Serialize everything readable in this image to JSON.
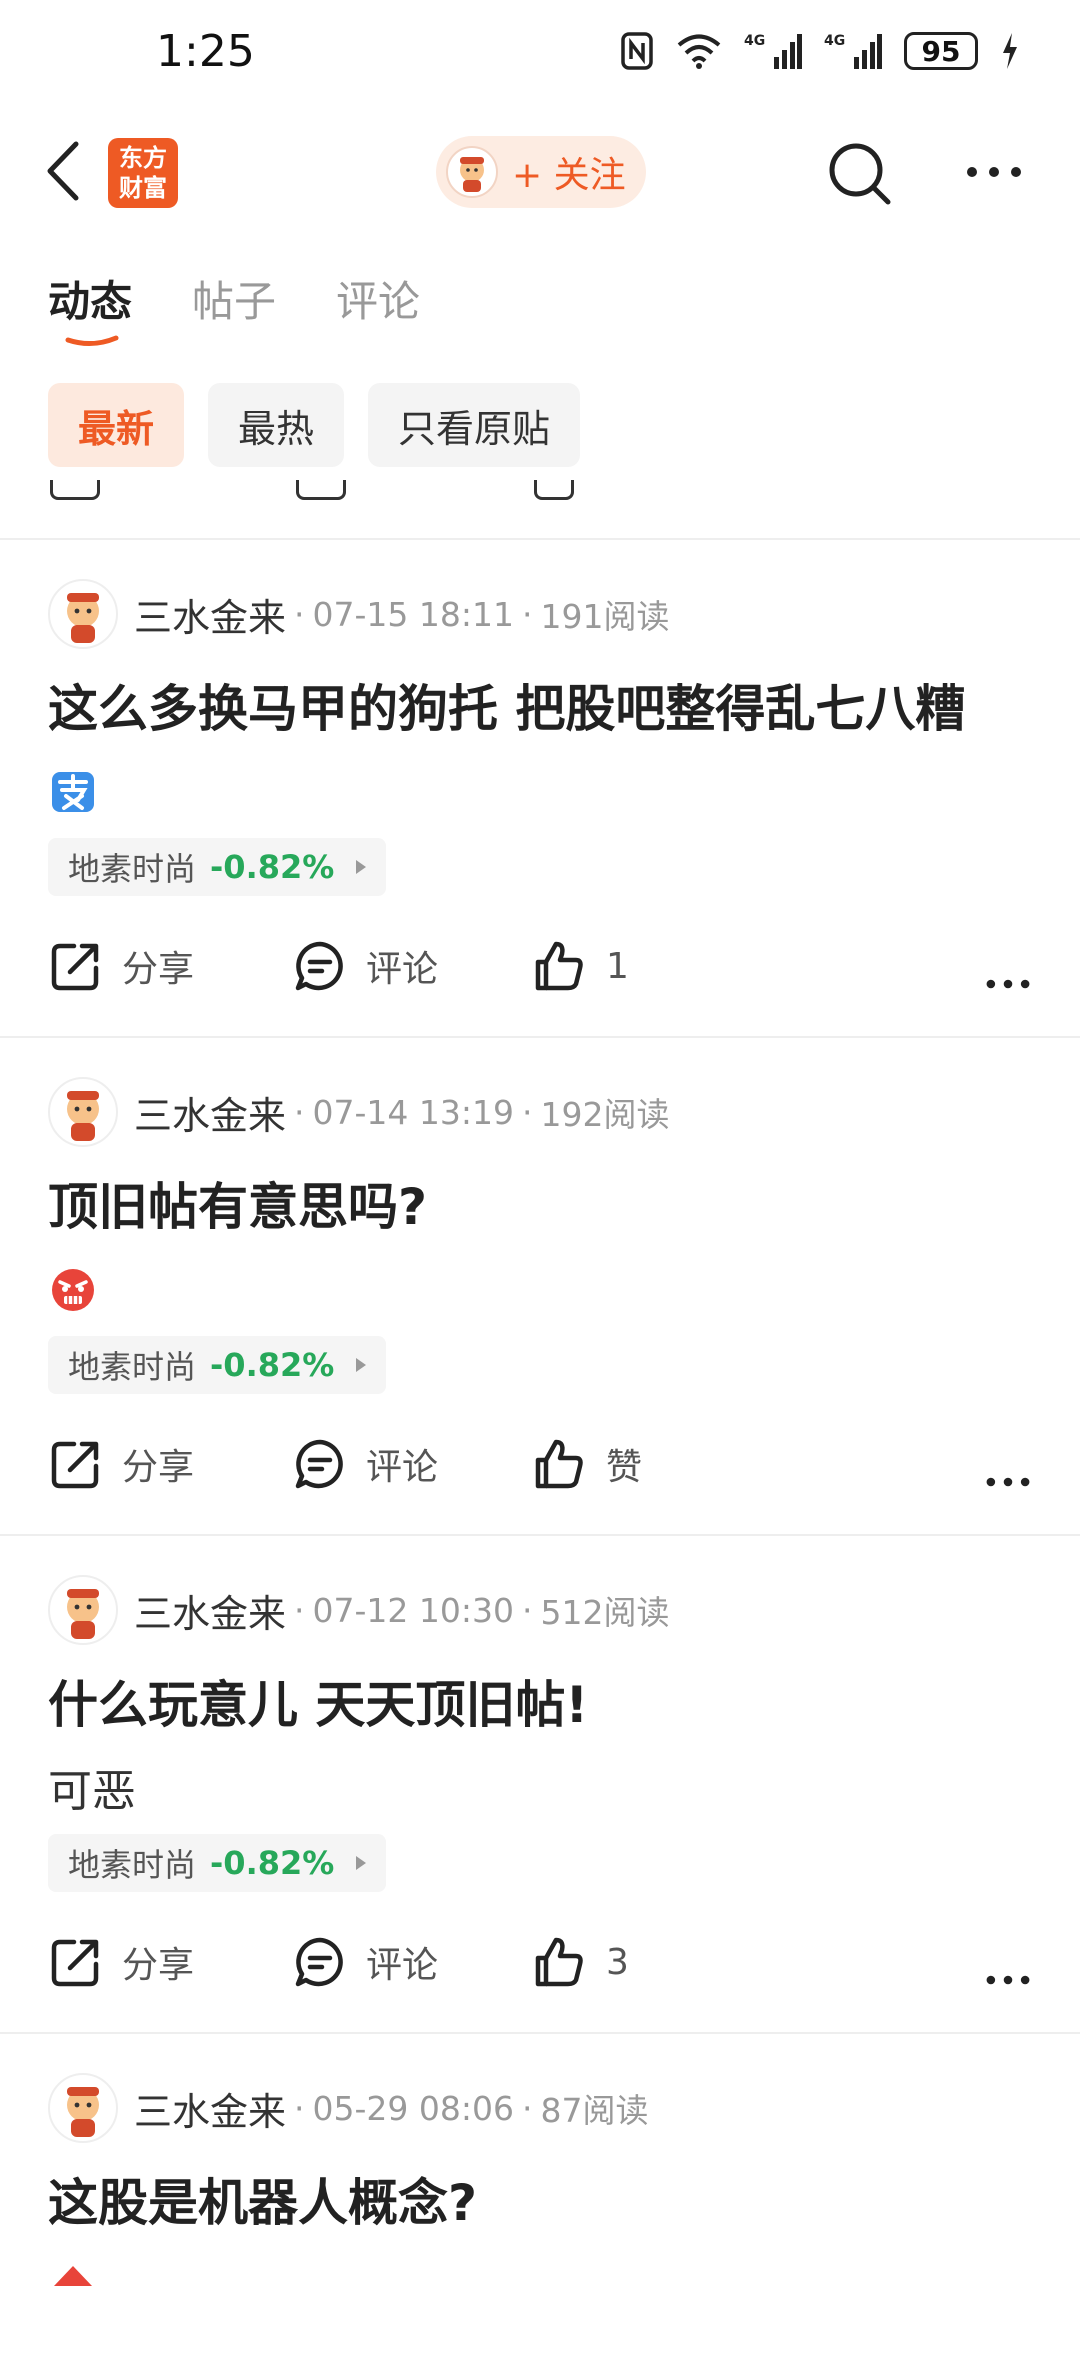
{
  "status_bar": {
    "time": "1:25",
    "network_1": "4G",
    "network_2": "4G",
    "battery": "95"
  },
  "header": {
    "brand_logo_text": "东方\n财富",
    "follow_label": "+ 关注"
  },
  "tabs": [
    {
      "label": "动态",
      "active": true
    },
    {
      "label": "帖子",
      "active": false
    },
    {
      "label": "评论",
      "active": false
    }
  ],
  "filters": [
    {
      "label": "最新",
      "active": true
    },
    {
      "label": "最热",
      "active": false
    },
    {
      "label": "只看原贴",
      "active": false
    }
  ],
  "actions": {
    "share": "分享",
    "comment": "评论"
  },
  "posts": [
    {
      "author": "三水金来",
      "date": "07-15 18:11",
      "reads": "191阅读",
      "title": "这么多换马甲的狗托 把股吧整得乱七八糟",
      "body_emoji": "sell-emoji",
      "stock_name": "地素时尚",
      "stock_change": "-0.82%",
      "like_label": "1"
    },
    {
      "author": "三水金来",
      "date": "07-14 13:19",
      "reads": "192阅读",
      "title": "顶旧帖有意思吗?",
      "body_emoji": "angry-face-emoji",
      "stock_name": "地素时尚",
      "stock_change": "-0.82%",
      "like_label": "赞"
    },
    {
      "author": "三水金来",
      "date": "07-12 10:30",
      "reads": "512阅读",
      "title": "什么玩意儿 天天顶旧帖!",
      "body_text": "可恶",
      "stock_name": "地素时尚",
      "stock_change": "-0.82%",
      "like_label": "3"
    },
    {
      "author": "三水金来",
      "date": "05-29 08:06",
      "reads": "87阅读",
      "title": "这股是机器人概念?"
    }
  ],
  "colors": {
    "accent": "#ee5a24",
    "stock_down": "#27a85a",
    "divider": "#eeeeee"
  }
}
